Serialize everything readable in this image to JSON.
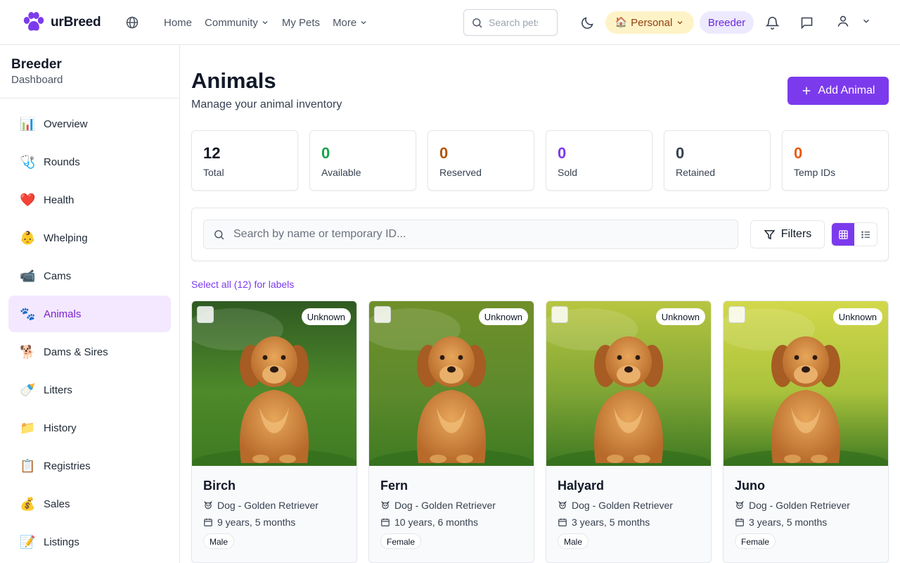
{
  "app": {
    "name": "urBreed",
    "brand_color": "#7c3aed"
  },
  "nav": {
    "items": [
      {
        "label": "Home",
        "has_dropdown": false
      },
      {
        "label": "Community",
        "has_dropdown": true
      },
      {
        "label": "My Pets",
        "has_dropdown": false
      },
      {
        "label": "More",
        "has_dropdown": true
      }
    ],
    "search_placeholder": "Search pets",
    "personal_label": "Personal",
    "personal_emoji": "🏠",
    "breeder_label": "Breeder"
  },
  "sidebar": {
    "title": "Breeder",
    "subtitle": "Dashboard",
    "items": [
      {
        "emoji": "📊",
        "label": "Overview",
        "active": false
      },
      {
        "emoji": "🩺",
        "label": "Rounds",
        "active": false
      },
      {
        "emoji": "❤️",
        "label": "Health",
        "active": false
      },
      {
        "emoji": "👶",
        "label": "Whelping",
        "active": false
      },
      {
        "emoji": "📹",
        "label": "Cams",
        "active": false
      },
      {
        "emoji": "🐾",
        "label": "Animals",
        "active": true
      },
      {
        "emoji": "🐕",
        "label": "Dams & Sires",
        "active": false
      },
      {
        "emoji": "🍼",
        "label": "Litters",
        "active": false
      },
      {
        "emoji": "📁",
        "label": "History",
        "active": false
      },
      {
        "emoji": "📋",
        "label": "Registries",
        "active": false
      },
      {
        "emoji": "💰",
        "label": "Sales",
        "active": false
      },
      {
        "emoji": "📝",
        "label": "Listings",
        "active": false
      }
    ]
  },
  "page": {
    "title": "Animals",
    "subtitle": "Manage your animal inventory",
    "add_button": "Add Animal"
  },
  "stats": [
    {
      "value": "12",
      "label": "Total",
      "color": "#111827"
    },
    {
      "value": "0",
      "label": "Available",
      "color": "#16a34a"
    },
    {
      "value": "0",
      "label": "Reserved",
      "color": "#b45309"
    },
    {
      "value": "0",
      "label": "Sold",
      "color": "#7c3aed"
    },
    {
      "value": "0",
      "label": "Retained",
      "color": "#374151"
    },
    {
      "value": "0",
      "label": "Temp IDs",
      "color": "#ea580c"
    }
  ],
  "filter": {
    "search_placeholder": "Search by name or temporary ID...",
    "filters_label": "Filters",
    "view_mode": "grid"
  },
  "select_all_label": "Select all (12) for labels",
  "animals": [
    {
      "name": "Birch",
      "species": "Dog - Golden Retriever",
      "age": "9 years, 5 months",
      "sex": "Male",
      "status": "Unknown"
    },
    {
      "name": "Fern",
      "species": "Dog - Golden Retriever",
      "age": "10 years, 6 months",
      "sex": "Female",
      "status": "Unknown"
    },
    {
      "name": "Halyard",
      "species": "Dog - Golden Retriever",
      "age": "3 years, 5 months",
      "sex": "Male",
      "status": "Unknown"
    },
    {
      "name": "Juno",
      "species": "Dog - Golden Retriever",
      "age": "3 years, 5 months",
      "sex": "Female",
      "status": "Unknown"
    }
  ]
}
